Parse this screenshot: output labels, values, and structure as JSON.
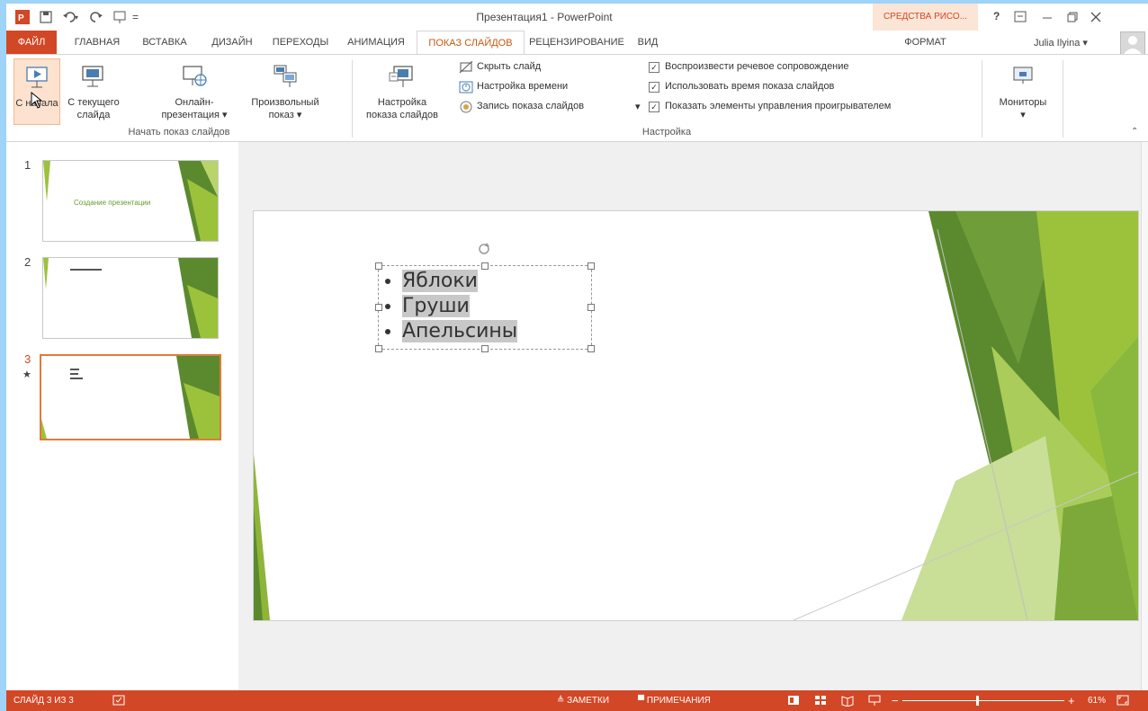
{
  "window": {
    "title": "Презентация1 - PowerPoint",
    "context_tab": "СРЕДСТВА РИСО...",
    "help": "?",
    "user": "Julia Ilyina",
    "user_caret": "▾"
  },
  "tabs": [
    {
      "label": "ФАЙЛ"
    },
    {
      "label": "ГЛАВНАЯ"
    },
    {
      "label": "ВСТАВКА"
    },
    {
      "label": "ДИЗАЙН"
    },
    {
      "label": "ПЕРЕХОДЫ"
    },
    {
      "label": "АНИМАЦИЯ"
    },
    {
      "label": "ПОКАЗ СЛАЙДОВ"
    },
    {
      "label": "РЕЦЕНЗИРОВАНИЕ"
    },
    {
      "label": "ВИД"
    },
    {
      "label": "ФОРМАТ"
    }
  ],
  "ribbon": {
    "start_group": {
      "from_start": "С начала",
      "from_current_1": "С текущего",
      "from_current_2": "слайда",
      "online_1": "Онлайн-",
      "online_2": "презентация ▾",
      "custom_1": "Произвольный",
      "custom_2": "показ ▾",
      "label": "Начать показ слайдов"
    },
    "setup_group": {
      "setup_1": "Настройка",
      "setup_2": "показа слайдов",
      "hide_slide": "Скрыть слайд",
      "rehearse": "Настройка времени",
      "record": "Запись показа слайдов",
      "record_caret": "▾",
      "narration": "Воспроизвести речевое сопровождение",
      "timings": "Использовать время показа слайдов",
      "media_controls": "Показать элементы управления проигрывателем",
      "label": "Настройка"
    },
    "monitors": {
      "label": "Мониторы",
      "caret": "▾"
    }
  },
  "slides": [
    {
      "number": "1",
      "title": "Создание презентации"
    },
    {
      "number": "2",
      "marker": ""
    },
    {
      "number": "3",
      "marker": "★"
    }
  ],
  "current_slide": {
    "bullets": [
      "Яблоки",
      "Груши",
      "Апельсины"
    ]
  },
  "status": {
    "slide_info": "СЛАЙД 3 ИЗ 3",
    "notes": "ЗАМЕТКИ",
    "comments": "ПРИМЕЧАНИЯ",
    "zoom_minus": "−",
    "zoom_plus": "+",
    "zoom": "61%"
  },
  "colors": {
    "accent": "#d24726",
    "green_dark": "#5b8a2e",
    "green_light": "#9cc23c"
  }
}
